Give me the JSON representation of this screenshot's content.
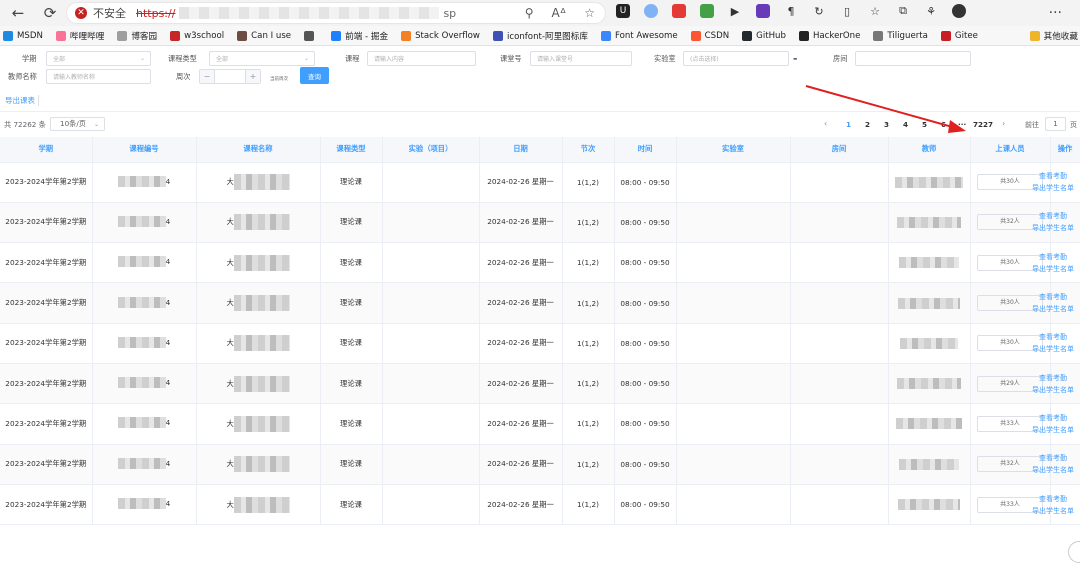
{
  "browser": {
    "unsafe_label": "不安全",
    "url_prefix": "https://",
    "url_suffix": "sp"
  },
  "bookmarks": [
    {
      "label": "MSDN",
      "color": "#1e88e5"
    },
    {
      "label": "哔哩哔哩",
      "color": "#fb7299"
    },
    {
      "label": "博客园",
      "color": "#9e9e9e"
    },
    {
      "label": "w3school",
      "color": "#c62828"
    },
    {
      "label": "Can I use",
      "color": "#6d4c41"
    },
    {
      "label": "",
      "color": "#555555"
    },
    {
      "label": "前端 - 掘金",
      "color": "#1e80ff"
    },
    {
      "label": "Stack Overflow",
      "color": "#f48024"
    },
    {
      "label": "iconfont-阿里图标库",
      "color": "#3f51b5"
    },
    {
      "label": "Font Awesome",
      "color": "#3a86ff"
    },
    {
      "label": "CSDN",
      "color": "#fc5531"
    },
    {
      "label": "GitHub",
      "color": "#24292e"
    },
    {
      "label": "HackerOne",
      "color": "#222222"
    },
    {
      "label": "Tiliguerta",
      "color": "#777777"
    },
    {
      "label": "Gitee",
      "color": "#c71d23"
    }
  ],
  "bookmark_other": "其他收藏",
  "filters": {
    "term_label": "学期",
    "term_value": "全部",
    "course_type_label": "课程类型",
    "course_type_value": "全部",
    "course_label": "课程",
    "course_placeholder": "请输入内容",
    "room_no_label": "课堂号",
    "room_no_placeholder": "请输入课堂号",
    "lab_label": "实验室",
    "lab_placeholder": "(点击选择)",
    "room_label": "房间",
    "teacher_label": "教师名称",
    "teacher_placeholder": "请输入教师名称",
    "week_label": "周次",
    "current_week_label": "当前周次",
    "query_button": "查询",
    "stepper_minus": "−",
    "stepper_plus": "+"
  },
  "export_label": "导出课表",
  "pagination": {
    "total": "共 72262 条",
    "page_size": "10条/页",
    "pages": [
      "1",
      "2",
      "3",
      "4",
      "5",
      "6"
    ],
    "ellipsis": "···",
    "last_page": "7227",
    "goto_label": "前往",
    "goto_value": "1",
    "page_unit": "页"
  },
  "table": {
    "headers": [
      "学期",
      "课程编号",
      "课程名称",
      "课程类型",
      "实验（项目）",
      "日期",
      "节次",
      "时间",
      "实验室",
      "房间",
      "教师",
      "上课人员",
      "操作"
    ],
    "rows": [
      {
        "term": "2023-2024学年第2学期",
        "code_suffix": "4",
        "name_prefix": "大",
        "type": "理论课",
        "date": "2024-02-26 星期一",
        "section": "1(1,2)",
        "time": "08:00 - 09:50",
        "count": "共30人"
      },
      {
        "term": "2023-2024学年第2学期",
        "code_suffix": "4",
        "name_prefix": "大",
        "type": "理论课",
        "date": "2024-02-26 星期一",
        "section": "1(1,2)",
        "time": "08:00 - 09:50",
        "count": "共32人"
      },
      {
        "term": "2023-2024学年第2学期",
        "code_suffix": "4",
        "name_prefix": "大",
        "type": "理论课",
        "date": "2024-02-26 星期一",
        "section": "1(1,2)",
        "time": "08:00 - 09:50",
        "count": "共30人"
      },
      {
        "term": "2023-2024学年第2学期",
        "code_suffix": "4",
        "name_prefix": "大",
        "type": "理论课",
        "date": "2024-02-26 星期一",
        "section": "1(1,2)",
        "time": "08:00 - 09:50",
        "count": "共30人"
      },
      {
        "term": "2023-2024学年第2学期",
        "code_suffix": "4",
        "name_prefix": "大",
        "type": "理论课",
        "date": "2024-02-26 星期一",
        "section": "1(1,2)",
        "time": "08:00 - 09:50",
        "count": "共30人"
      },
      {
        "term": "2023-2024学年第2学期",
        "code_suffix": "4",
        "name_prefix": "大",
        "type": "理论课",
        "date": "2024-02-26 星期一",
        "section": "1(1,2)",
        "time": "08:00 - 09:50",
        "count": "共29人"
      },
      {
        "term": "2023-2024学年第2学期",
        "code_suffix": "4",
        "name_prefix": "大",
        "type": "理论课",
        "date": "2024-02-26 星期一",
        "section": "1(1,2)",
        "time": "08:00 - 09:50",
        "count": "共33人"
      },
      {
        "term": "2023-2024学年第2学期",
        "code_suffix": "4",
        "name_prefix": "大",
        "type": "理论课",
        "date": "2024-02-26 星期一",
        "section": "1(1,2)",
        "time": "08:00 - 09:50",
        "count": "共32人"
      },
      {
        "term": "2023-2024学年第2学期",
        "code_suffix": "4",
        "name_prefix": "大",
        "type": "理论课",
        "date": "2024-02-26 星期一",
        "section": "1(1,2)",
        "time": "08:00 - 09:50",
        "count": "共33人"
      }
    ],
    "op_view": "查看考勤",
    "op_export": "导出学生名单"
  },
  "colors": {
    "accent": "#409eff",
    "annotation": "#e02020"
  }
}
